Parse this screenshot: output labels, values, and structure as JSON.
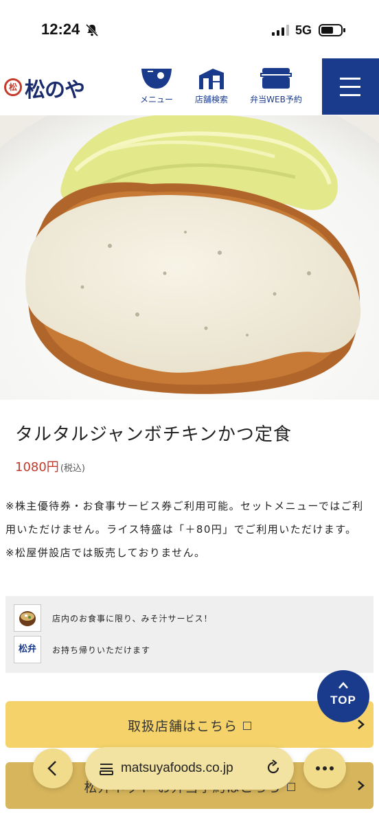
{
  "status_bar": {
    "time": "12:24",
    "network": "5G",
    "icons": [
      "bell-slash-icon",
      "signal-icon",
      "battery-icon"
    ]
  },
  "header": {
    "logo_text": "松のや",
    "logo_seal": "松",
    "nav": [
      {
        "label": "メニュー",
        "icon": "bowl-icon"
      },
      {
        "label": "店舗検索",
        "icon": "store-icon"
      },
      {
        "label": "弁当WEB予約",
        "icon": "bento-box-icon"
      }
    ],
    "menu_icon": "hamburger-icon",
    "brand_color": "#1a3a8c"
  },
  "product": {
    "title": "タルタルジャンボチキンかつ定食",
    "price": "1080円",
    "tax_note": "(税込)",
    "notes": [
      "※株主優待券・お食事サービス券ご利用可能。セットメニューではご利用いただけません。ライス特盛は「＋80円」でご利用いただけます。",
      "※松屋併設店では販売しておりません。"
    ],
    "price_color": "#c0392b"
  },
  "services": [
    {
      "icon": "miso-soup-icon",
      "text": "店内のお食事に限り、みそ汁サービス！"
    },
    {
      "icon": "matsuben-icon",
      "icon_text": "松弁",
      "text": "お持ち帰りいただけます"
    }
  ],
  "top_button": {
    "label": "TOP"
  },
  "buttons": [
    {
      "label": "取扱店舗はこちら",
      "color": "#f5d36a"
    },
    {
      "label": "松弁ネット お弁当予約はこちら",
      "color": "#d6b55c"
    }
  ],
  "browser": {
    "url": "matsuyafoods.co.jp"
  }
}
